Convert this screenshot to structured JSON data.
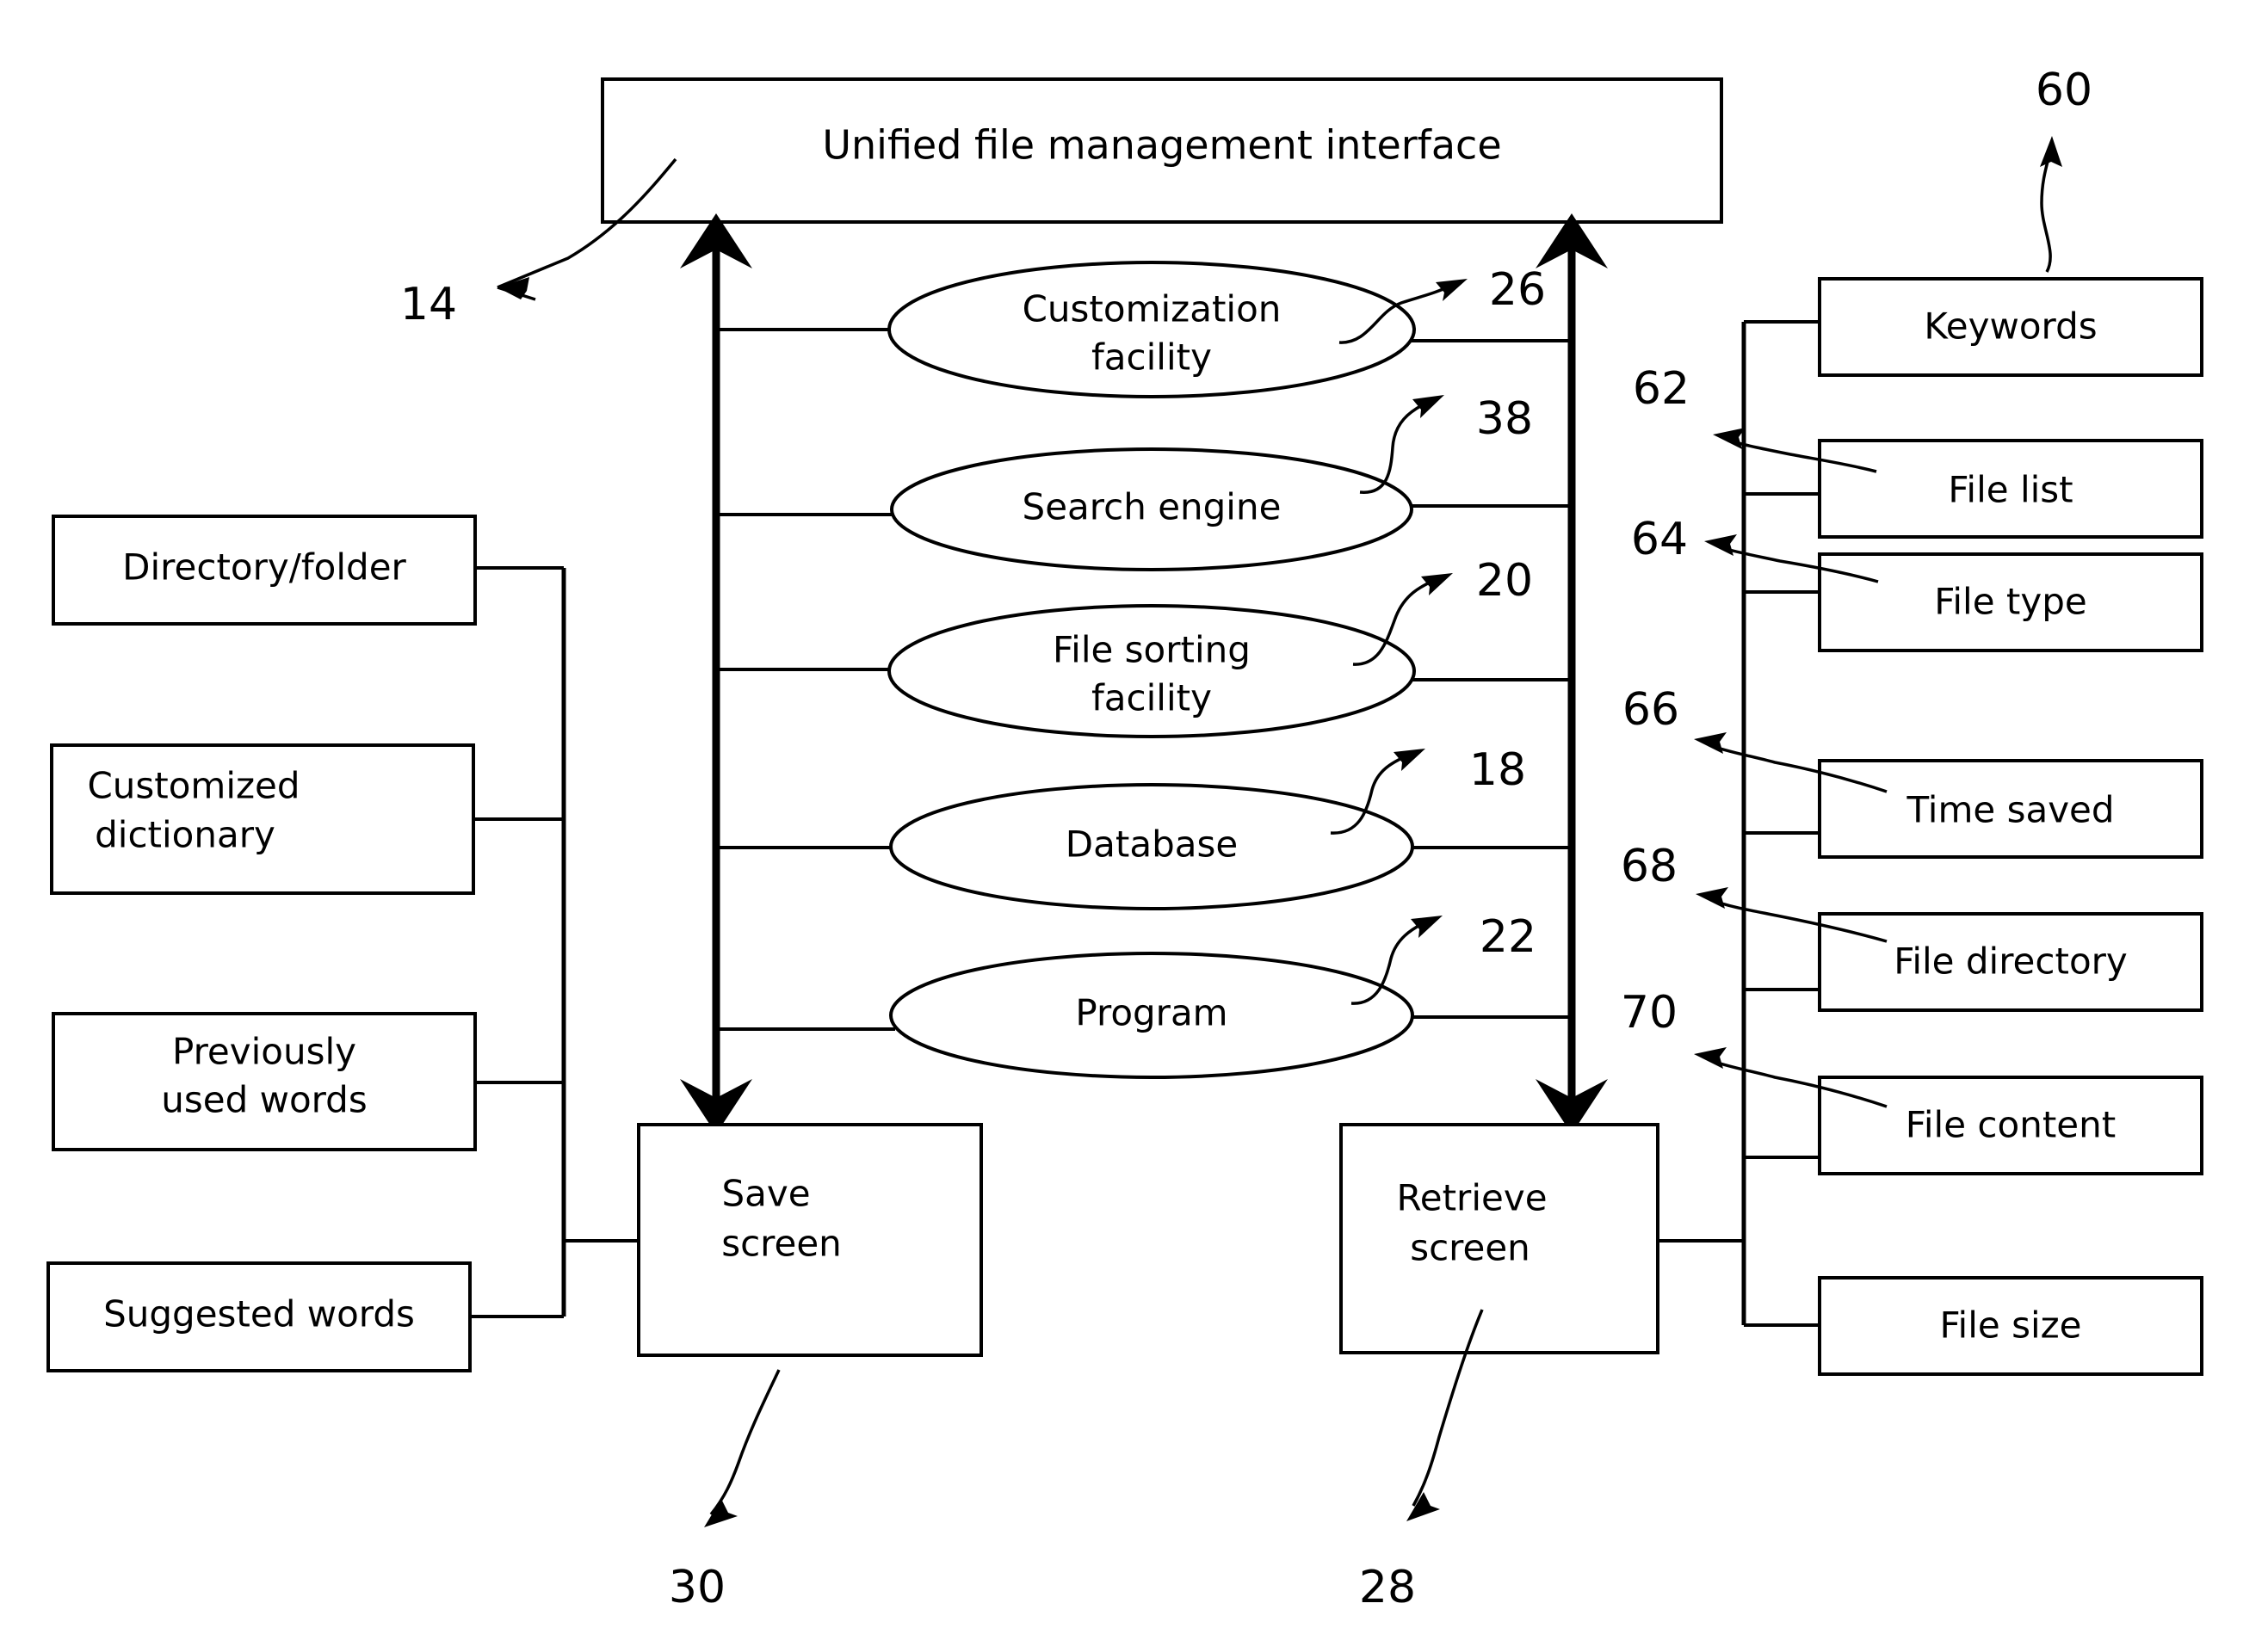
{
  "figure": {
    "title_box": {
      "label": "Unified file management interface",
      "ref": "14"
    },
    "center_nodes": [
      {
        "label_line1": "Customization",
        "label_line2": "facility",
        "ref": "26"
      },
      {
        "label_line1": "Search engine",
        "label_line2": "",
        "ref": "38"
      },
      {
        "label_line1": "File sorting",
        "label_line2": "facility",
        "ref": "20"
      },
      {
        "label_line1": "Database",
        "label_line2": "",
        "ref": "18"
      },
      {
        "label_line1": "Program",
        "label_line2": "",
        "ref": "22"
      }
    ],
    "left_nodes": [
      {
        "label_line1": "Directory/folder",
        "label_line2": ""
      },
      {
        "label_line1": "Customized",
        "label_line2": "dictionary"
      },
      {
        "label_line1": "Previously",
        "label_line2": "used words"
      },
      {
        "label_line1": "Suggested words",
        "label_line2": ""
      }
    ],
    "right_nodes": [
      {
        "label": "Keywords",
        "ref": "60"
      },
      {
        "label": "File list",
        "ref": "62"
      },
      {
        "label": "File type",
        "ref": "64"
      },
      {
        "label": "Time saved",
        "ref": "66"
      },
      {
        "label": "File directory",
        "ref": "68"
      },
      {
        "label": "File content",
        "ref": "70"
      },
      {
        "label": "File size",
        "ref": ""
      }
    ],
    "bottom_nodes": [
      {
        "label_line1": "Save",
        "label_line2": "screen",
        "ref": "30"
      },
      {
        "label_line1": "Retrieve",
        "label_line2": "screen",
        "ref": "28"
      }
    ],
    "colors": {
      "stroke": "#000000",
      "background": "#ffffff"
    }
  }
}
